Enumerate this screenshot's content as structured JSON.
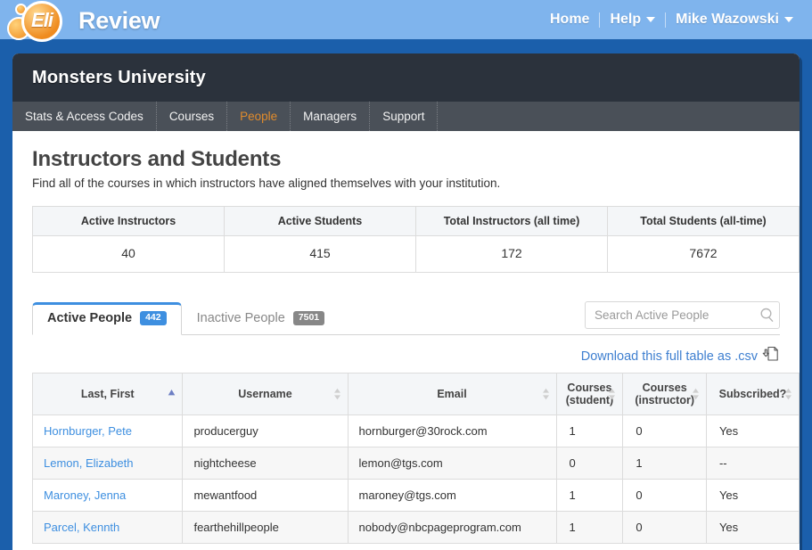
{
  "brand": {
    "logo_text": "Eli",
    "name": "Review",
    "logo_icon": "eli-circles-logo"
  },
  "topnav": {
    "items": [
      {
        "label": "Home",
        "caret": false
      },
      {
        "label": "Help",
        "caret": true
      },
      {
        "label": "Mike Wazowski",
        "caret": true
      }
    ]
  },
  "institution": {
    "name": "Monsters University"
  },
  "subnav": {
    "items": [
      {
        "label": "Stats & Access Codes",
        "active": false
      },
      {
        "label": "Courses",
        "active": false
      },
      {
        "label": "People",
        "active": true
      },
      {
        "label": "Managers",
        "active": false
      },
      {
        "label": "Support",
        "active": false
      }
    ]
  },
  "page": {
    "title": "Instructors and Students",
    "subtitle": "Find all of the courses in which instructors have aligned themselves with your institution."
  },
  "stats": {
    "headers": [
      "Active Instructors",
      "Active Students",
      "Total Instructors (all time)",
      "Total Students (all-time)"
    ],
    "values": [
      "40",
      "415",
      "172",
      "7672"
    ]
  },
  "people_tabs": [
    {
      "label": "Active People",
      "count": "442",
      "active": true
    },
    {
      "label": "Inactive People",
      "count": "7501",
      "active": false
    }
  ],
  "search": {
    "placeholder": "Search Active People",
    "value": "",
    "icon": "search-icon"
  },
  "csv": {
    "label": "Download this full table as .csv",
    "icon": "download-document-icon"
  },
  "table": {
    "headers": [
      {
        "label": "Last, First",
        "sort": "asc"
      },
      {
        "label": "Username",
        "sort": "none"
      },
      {
        "label": "Email",
        "sort": "none"
      },
      {
        "label": "Courses\n(student)",
        "line1": "Courses",
        "line2": "(student)",
        "sort": "none"
      },
      {
        "label": "Courses\n(instructor)",
        "line1": "Courses",
        "line2": "(instructor)",
        "sort": "none"
      },
      {
        "label": "Subscribed?",
        "sort": "none"
      }
    ],
    "rows": [
      {
        "name": "Hornburger, Pete",
        "username": "producerguy",
        "email": "hornburger@30rock.com",
        "courses_student": "1",
        "courses_instructor": "0",
        "subscribed": "Yes"
      },
      {
        "name": "Lemon, Elizabeth",
        "username": "nightcheese",
        "email": "lemon@tgs.com",
        "courses_student": "0",
        "courses_instructor": "1",
        "subscribed": "--"
      },
      {
        "name": "Maroney, Jenna",
        "username": "mewantfood",
        "email": "maroney@tgs.com",
        "courses_student": "1",
        "courses_instructor": "0",
        "subscribed": "Yes"
      },
      {
        "name": "Parcel, Kennth",
        "username": "fearthehillpeople",
        "email": "nobody@nbcpageprogram.com",
        "courses_student": "1",
        "courses_instructor": "0",
        "subscribed": "Yes"
      }
    ]
  },
  "colors": {
    "page_background": "#1b5fab",
    "topbar": "#7fb4ed",
    "institution_header": "#2b323c",
    "subnav": "#4a5058",
    "accent_orange": "#e08b2c",
    "link_blue": "#3e8fe0",
    "badge_blue": "#3e8fe0",
    "badge_grey": "#878787"
  }
}
